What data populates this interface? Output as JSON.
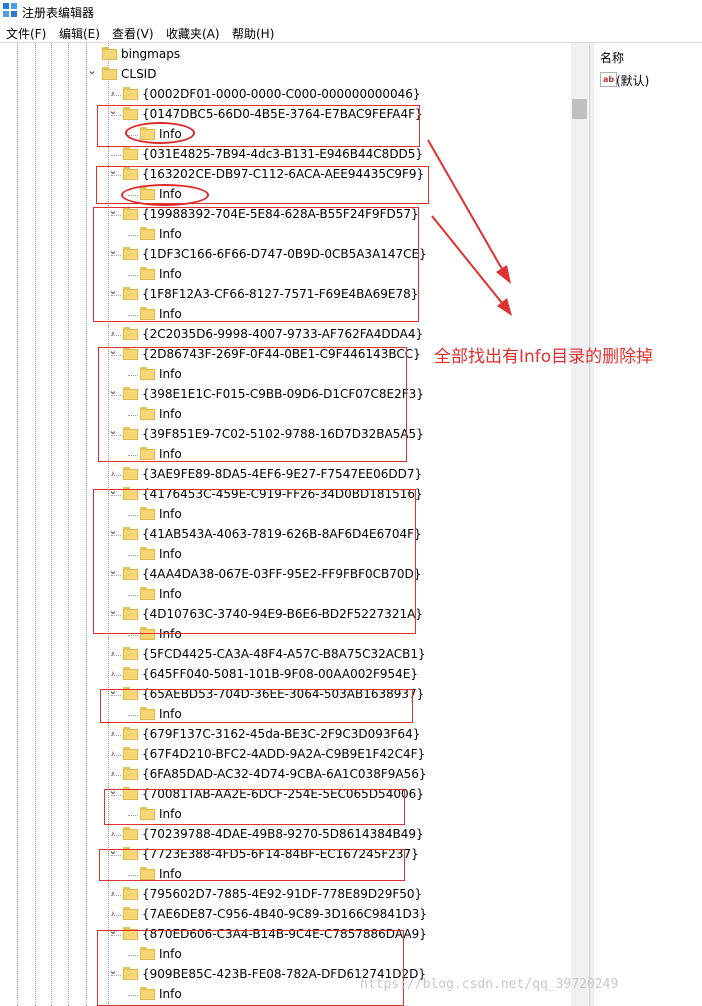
{
  "window": {
    "title": "注册表编辑器"
  },
  "menu": [
    "文件(F)",
    "编辑(E)",
    "查看(V)",
    "收藏夹(A)",
    "帮助(H)"
  ],
  "list_pane": {
    "column_name": "名称",
    "default_value_label": "(默认)",
    "value_icon_label": "ab"
  },
  "tree": [
    {
      "label": "bingmaps",
      "level": 0,
      "expander": ""
    },
    {
      "label": "CLSID",
      "level": 0,
      "expander": "expanded"
    },
    {
      "label": "{0002DF01-0000-0000-C000-000000000046}",
      "level": 1,
      "expander": "collapsed"
    },
    {
      "label": "{0147DBC5-66D0-4B5E-3764-E7BAC9FEFA4F}",
      "level": 1,
      "expander": "expanded"
    },
    {
      "label": "Info",
      "level": 2,
      "expander": ""
    },
    {
      "label": "{031E4825-7B94-4dc3-B131-E946B44C8DD5}",
      "level": 1,
      "expander": ""
    },
    {
      "label": "{163202CE-DB97-C112-6ACA-AEE94435C9F9}",
      "level": 1,
      "expander": "expanded"
    },
    {
      "label": "Info",
      "level": 2,
      "expander": ""
    },
    {
      "label": "{19988392-704E-5E84-628A-B55F24F9FD57}",
      "level": 1,
      "expander": "expanded"
    },
    {
      "label": "Info",
      "level": 2,
      "expander": ""
    },
    {
      "label": "{1DF3C166-6F66-D747-0B9D-0CB5A3A147CE}",
      "level": 1,
      "expander": "expanded"
    },
    {
      "label": "Info",
      "level": 2,
      "expander": ""
    },
    {
      "label": "{1F8F12A3-CF66-8127-7571-F69E4BA69E78}",
      "level": 1,
      "expander": "expanded"
    },
    {
      "label": "Info",
      "level": 2,
      "expander": ""
    },
    {
      "label": "{2C2035D6-9998-4007-9733-AF762FA4DDA4}",
      "level": 1,
      "expander": "collapsed"
    },
    {
      "label": "{2D86743F-269F-0F44-0BE1-C9F446143BCC}",
      "level": 1,
      "expander": "expanded"
    },
    {
      "label": "Info",
      "level": 2,
      "expander": ""
    },
    {
      "label": "{398E1E1C-F015-C9BB-09D6-D1CF07C8E2F3}",
      "level": 1,
      "expander": "expanded"
    },
    {
      "label": "Info",
      "level": 2,
      "expander": ""
    },
    {
      "label": "{39F851E9-7C02-5102-9788-16D7D32BA5A5}",
      "level": 1,
      "expander": "expanded"
    },
    {
      "label": "Info",
      "level": 2,
      "expander": ""
    },
    {
      "label": "{3AE9FE89-8DA5-4EF6-9E27-F7547EE06DD7}",
      "level": 1,
      "expander": "collapsed"
    },
    {
      "label": "{4176453C-459E-C919-FF26-34D0BD181516}",
      "level": 1,
      "expander": "expanded"
    },
    {
      "label": "Info",
      "level": 2,
      "expander": ""
    },
    {
      "label": "{41AB543A-4063-7819-626B-8AF6D4E6704F}",
      "level": 1,
      "expander": "expanded"
    },
    {
      "label": "Info",
      "level": 2,
      "expander": ""
    },
    {
      "label": "{4AA4DA38-067E-03FF-95E2-FF9FBF0CB70D}",
      "level": 1,
      "expander": "expanded"
    },
    {
      "label": "Info",
      "level": 2,
      "expander": ""
    },
    {
      "label": "{4D10763C-3740-94E9-B6E6-BD2F5227321A}",
      "level": 1,
      "expander": "expanded"
    },
    {
      "label": "Info",
      "level": 2,
      "expander": ""
    },
    {
      "label": "{5FCD4425-CA3A-48F4-A57C-B8A75C32ACB1}",
      "level": 1,
      "expander": "collapsed"
    },
    {
      "label": "{645FF040-5081-101B-9F08-00AA002F954E}",
      "level": 1,
      "expander": "collapsed"
    },
    {
      "label": "{65AEBD53-704D-36EE-3064-503AB1638937}",
      "level": 1,
      "expander": "expanded"
    },
    {
      "label": "Info",
      "level": 2,
      "expander": ""
    },
    {
      "label": "{679F137C-3162-45da-BE3C-2F9C3D093F64}",
      "level": 1,
      "expander": "collapsed"
    },
    {
      "label": "{67F4D210-BFC2-4ADD-9A2A-C9B9E1F42C4F}",
      "level": 1,
      "expander": "collapsed"
    },
    {
      "label": "{6FA85DAD-AC32-4D74-9CBA-6A1C038F9A56}",
      "level": 1,
      "expander": "collapsed"
    },
    {
      "label": "{70081TAB-AA2E-6DCF-254E-5EC065D54006}",
      "level": 1,
      "expander": "expanded"
    },
    {
      "label": "Info",
      "level": 2,
      "expander": ""
    },
    {
      "label": "{70239788-4DAE-49B8-9270-5D8614384B49}",
      "level": 1,
      "expander": "collapsed"
    },
    {
      "label": "{7723E388-4FD5-6F14-84BF-EC167245F237}",
      "level": 1,
      "expander": "expanded"
    },
    {
      "label": "Info",
      "level": 2,
      "expander": ""
    },
    {
      "label": "{795602D7-7885-4E92-91DF-778E89D29F50}",
      "level": 1,
      "expander": "collapsed"
    },
    {
      "label": "{7AE6DE87-C956-4B40-9C89-3D166C9841D3}",
      "level": 1,
      "expander": "collapsed"
    },
    {
      "label": "{870ED606-C3A4-B14B-9C4E-C7857886DAA9}",
      "level": 1,
      "expander": "expanded"
    },
    {
      "label": "Info",
      "level": 2,
      "expander": ""
    },
    {
      "label": "{909BE85C-423B-FE08-782A-DFD612741D2D}",
      "level": 1,
      "expander": "expanded"
    },
    {
      "label": "Info",
      "level": 2,
      "expander": ""
    }
  ],
  "annotation": {
    "text": "全部找出有Info目录的删除掉",
    "color": "#e03030"
  },
  "watermark": "https://blog.csdn.net/qq_39720249",
  "colors": {
    "folder": "#f6d776",
    "annotation": "#e03030"
  }
}
